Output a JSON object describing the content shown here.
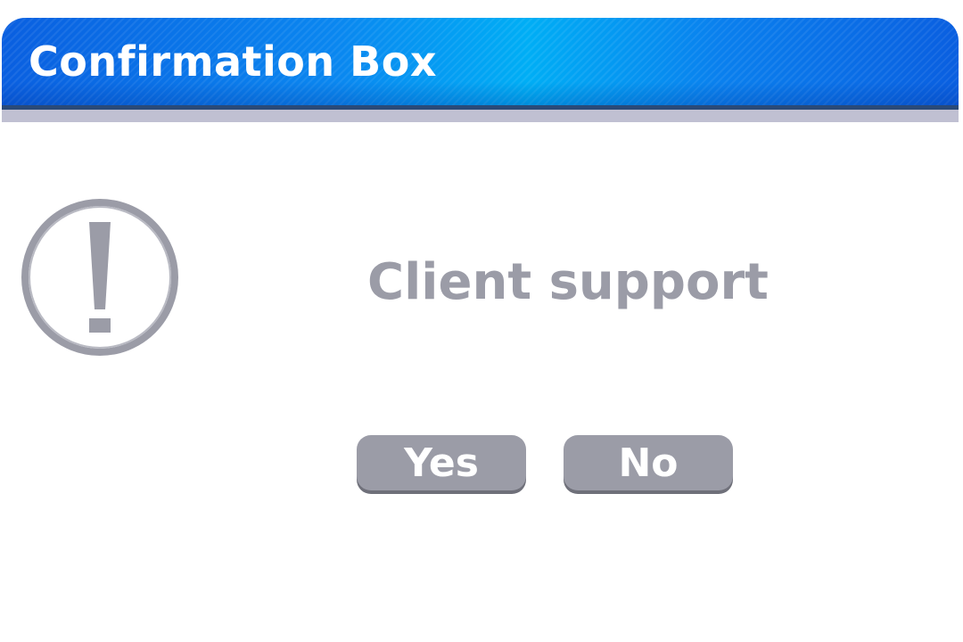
{
  "dialog": {
    "title": "Confirmation Box",
    "message": "Client support",
    "icon": "exclamation-circle-icon",
    "buttons": {
      "yes_label": "Yes",
      "no_label": "No"
    }
  },
  "colors": {
    "titlebar_blue": "#0a7ff0",
    "divider": "#c0c0d2",
    "content_gray": "#9b9ca7",
    "button_text": "#ffffff"
  }
}
